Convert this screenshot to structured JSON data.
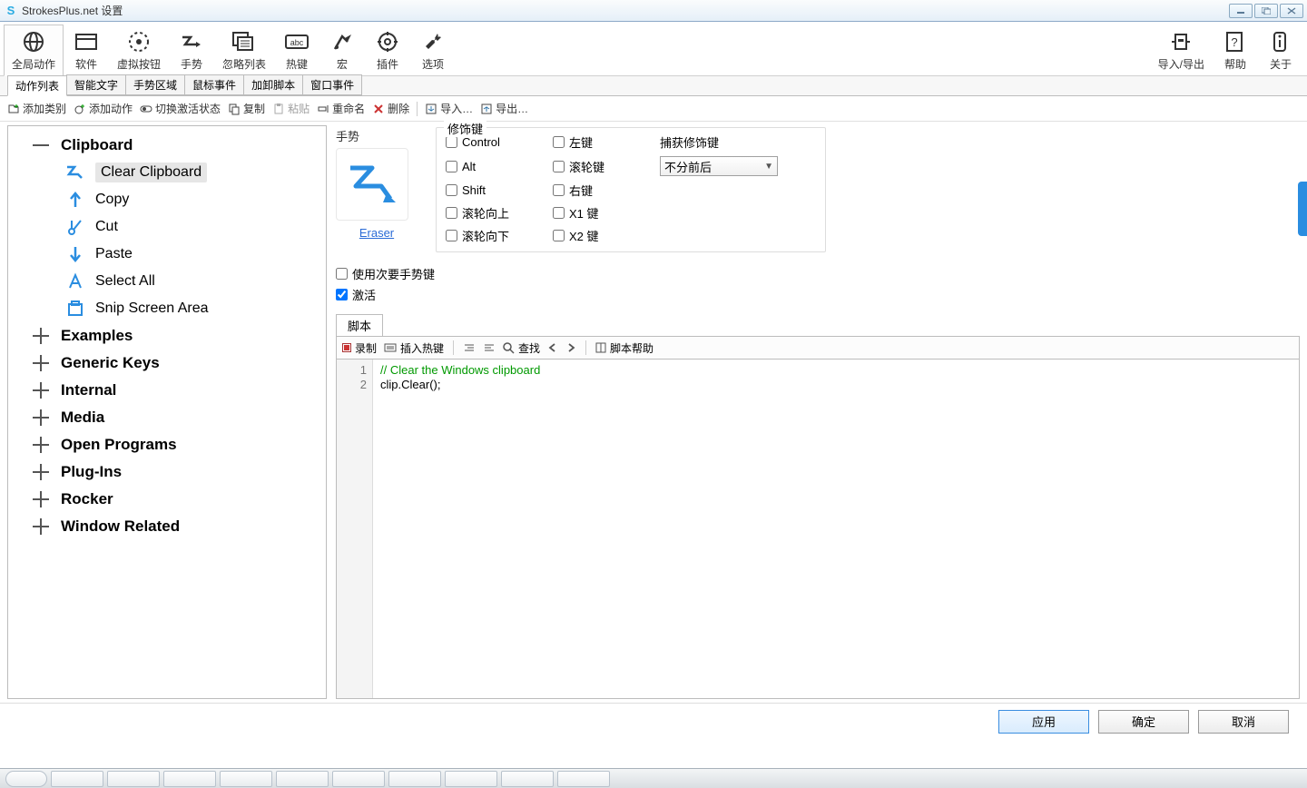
{
  "titlebar": {
    "title": "StrokesPlus.net 设置"
  },
  "toolbar": {
    "global": "全局动作",
    "software": "软件",
    "virtual_button": "虚拟按钮",
    "gesture": "手势",
    "ignore_list": "忽略列表",
    "hotkey": "热键",
    "macro": "宏",
    "plugin": "插件",
    "options": "选项",
    "import_export": "导入/导出",
    "help": "帮助",
    "about": "关于"
  },
  "secTabs": {
    "action_list": "动作列表",
    "smart_text": "智能文字",
    "gesture_region": "手势区域",
    "mouse_events": "鼠标事件",
    "load_script": "加卸脚本",
    "window_events": "窗口事件"
  },
  "subToolbar": {
    "add_category": "添加类别",
    "add_action": "添加动作",
    "toggle_active": "切换激活状态",
    "copy": "复制",
    "paste": "粘贴",
    "rename": "重命名",
    "delete": "删除",
    "import": "导入…",
    "export": "导出…"
  },
  "tree": {
    "clipboard": "Clipboard",
    "clear_clipboard": "Clear Clipboard",
    "copy": "Copy",
    "cut": "Cut",
    "paste": "Paste",
    "select_all": "Select All",
    "snip": "Snip Screen Area",
    "examples": "Examples",
    "generic_keys": "Generic Keys",
    "internal": "Internal",
    "media": "Media",
    "open_programs": "Open Programs",
    "plug_ins": "Plug-Ins",
    "rocker": "Rocker",
    "window_related": "Window Related"
  },
  "right": {
    "gesture_label": "手势",
    "gesture_name": "Eraser",
    "mod_label": "修饰键",
    "control": "Control",
    "alt": "Alt",
    "shift": "Shift",
    "wheel_up": "滚轮向上",
    "wheel_down": "滚轮向下",
    "left": "左键",
    "wheel": "滚轮键",
    "right": "右键",
    "x1": "X1 键",
    "x2": "X2 键",
    "capture_label": "捕获修饰键",
    "capture_value": "不分前后",
    "use_secondary": "使用次要手势键",
    "activate": "激活"
  },
  "script": {
    "tab": "脚本",
    "record": "录制",
    "insert_hotkey": "插入热键",
    "find": "查找",
    "script_help": "脚本帮助",
    "line1": "// Clear the Windows clipboard",
    "line2a": "clip",
    "line2b": ".Clear();"
  },
  "footer": {
    "apply": "应用",
    "ok": "确定",
    "cancel": "取消"
  }
}
